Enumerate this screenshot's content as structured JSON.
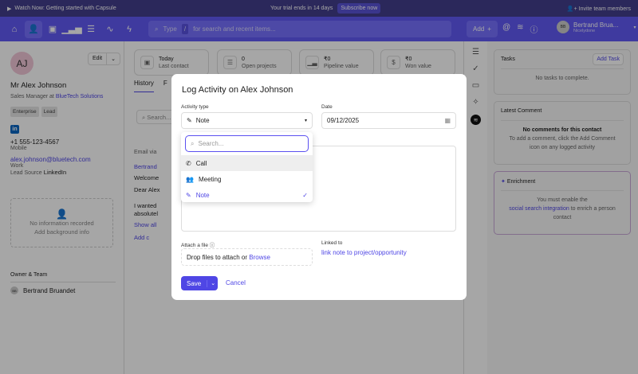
{
  "topbar": {
    "watch": "Watch Now: Getting started with Capsule",
    "trial": "Your trial ends in 14 days",
    "subscribe": "Subscribe now",
    "invite": "Invite team members"
  },
  "nav": {
    "search_type": "Type",
    "search_slash": "/",
    "search_placeholder": "for search and recent items...",
    "add": "Add",
    "user_initials": "BB",
    "user_name": "Bertrand Brua...",
    "user_org": "Nicelydone"
  },
  "contact": {
    "initials": "AJ",
    "edit": "Edit",
    "name": "Mr Alex Johnson",
    "title_prefix": "Sales Manager at",
    "company": "BlueTech Solutions",
    "tags": [
      "Enterprise",
      "Lead"
    ],
    "phone": "+1 555-123-4567",
    "phone_type": "Mobile",
    "email": "alex.johnson@bluetech.com",
    "email_type": "Work",
    "lead_source_label": "Lead Source",
    "lead_source": "LinkedIn",
    "no_info": "No information recorded",
    "add_bg": "Add background info",
    "owner_heading": "Owner & Team",
    "owner_initials": "BB",
    "owner": "Bertrand Bruandet"
  },
  "stats": [
    {
      "value": "Today",
      "label": "Last contact"
    },
    {
      "value": "0",
      "label": "Open projects"
    },
    {
      "value": "₹0",
      "label": "Pipeline value"
    },
    {
      "value": "₹0",
      "label": "Won value"
    }
  ],
  "tabs": [
    "History",
    "F"
  ],
  "history": {
    "search": "Search...",
    "email_via": "Email via",
    "author": "Bertrand",
    "subject": "Welcome",
    "greeting": "Dear Alex",
    "body1": "I wanted",
    "body2": "absolutel",
    "show_all": "Show all",
    "add_comment": "Add c"
  },
  "right": {
    "tasks_title": "Tasks",
    "add_task": "Add Task",
    "no_tasks": "No tasks to complete.",
    "comment_title": "Latest Comment",
    "no_comments": "No comments for this contact",
    "comment_hint1": "To add a comment, click the Add Comment",
    "comment_hint2": "icon on any logged activity",
    "enrich_title": "Enrichment",
    "enrich1": "You must enable the",
    "enrich_link": "social search integration",
    "enrich2": "to enrich a person",
    "enrich3": "contact"
  },
  "modal": {
    "title": "Log Activity on Alex Johnson",
    "activity_label": "Activity type",
    "activity_value": "Note",
    "date_label": "Date",
    "date_value": "09/12/2025",
    "search_placeholder": "Search...",
    "options": [
      "Call",
      "Meeting",
      "Note"
    ],
    "attach_label": "Attach a file",
    "drop_text": "Drop files to attach or",
    "browse": "Browse",
    "linked_label": "Linked to",
    "linked_link": "link note to project/opportunity",
    "save": "Save",
    "cancel": "Cancel"
  }
}
